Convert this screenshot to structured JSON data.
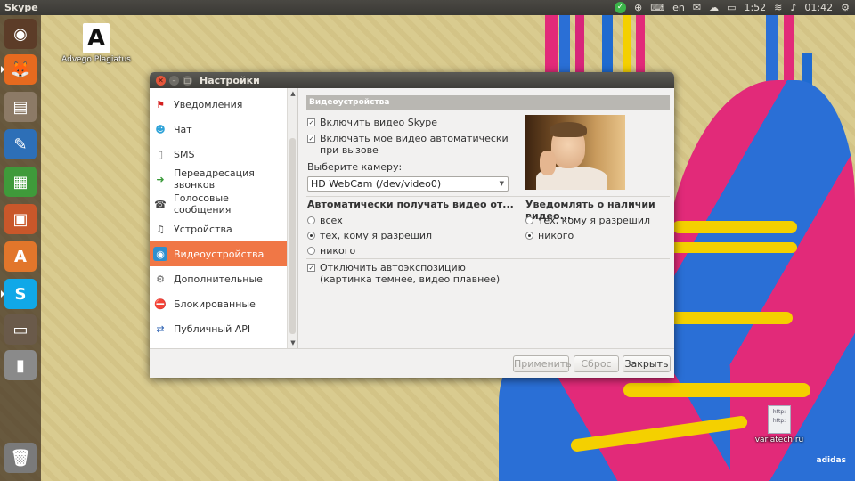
{
  "top_panel": {
    "app_title": "Skype",
    "keyboard_layout": "en",
    "battery_time": "1:52",
    "clock": "01:42"
  },
  "desktop": {
    "icons": [
      {
        "label": "Advego Plagiatus",
        "glyph": "A"
      },
      {
        "label": "variatech.ru",
        "glyph_lines": [
          "http:",
          "http:"
        ]
      }
    ]
  },
  "launcher": {
    "items": [
      {
        "name": "ubuntu-dash",
        "glyph": "◉",
        "color": "#5c3c28"
      },
      {
        "name": "firefox",
        "glyph": "🦊",
        "color": "#e66a1f"
      },
      {
        "name": "files",
        "glyph": "▤",
        "color": "#8c7a66"
      },
      {
        "name": "writer",
        "glyph": "✎",
        "color": "#2d6fb7"
      },
      {
        "name": "calc",
        "glyph": "▦",
        "color": "#3f9a3a"
      },
      {
        "name": "impress",
        "glyph": "▣",
        "color": "#c9572a"
      },
      {
        "name": "software-center",
        "glyph": "A",
        "color": "#e2762b"
      },
      {
        "name": "skype",
        "glyph": "S",
        "color": "#10a8e8"
      },
      {
        "name": "workspaces",
        "glyph": "▭",
        "color": "#6a5a4a"
      },
      {
        "name": "usb-drive",
        "glyph": "▮",
        "color": "#8a8a8a"
      },
      {
        "name": "trash",
        "glyph": "🗑",
        "color": "#7a7a7a"
      }
    ]
  },
  "window": {
    "title": "Настройки",
    "sidebar": {
      "items": [
        {
          "label": "Уведомления",
          "icon": "flag-icon",
          "glyph": "⚑",
          "color": "#d42020",
          "selected": false
        },
        {
          "label": "Чат",
          "icon": "chat-icon",
          "glyph": "☻",
          "color": "#2fa3d8",
          "selected": false
        },
        {
          "label": "SMS",
          "icon": "phone-icon",
          "glyph": "▯",
          "color": "#777777",
          "selected": false
        },
        {
          "label": "Переадресация звонков",
          "icon": "forward-call-icon",
          "glyph": "➜",
          "color": "#3a9a3a",
          "selected": false
        },
        {
          "label": "Голосовые сообщения",
          "icon": "voicemail-icon",
          "glyph": "☎",
          "color": "#444444",
          "selected": false
        },
        {
          "label": "Устройства",
          "icon": "headset-icon",
          "glyph": "♫",
          "color": "#555555",
          "selected": false
        },
        {
          "label": "Видеоустройства",
          "icon": "webcam-icon",
          "glyph": "◉",
          "color": "#2f8fcf",
          "selected": true
        },
        {
          "label": "Дополнительные",
          "icon": "gear-icon",
          "glyph": "⚙",
          "color": "#666666",
          "selected": false
        },
        {
          "label": "Блокированные",
          "icon": "blocked-user-icon",
          "glyph": "⛔",
          "color": "#c88a3a",
          "selected": false
        },
        {
          "label": "Публичный API",
          "icon": "api-arrows-icon",
          "glyph": "⇄",
          "color": "#2a5fb0",
          "selected": false
        }
      ]
    },
    "content": {
      "section_title": "Видеоустройства",
      "enable_video": {
        "label": "Включить видео Skype",
        "checked": true
      },
      "auto_start_video": {
        "label_line1": "Включать мое видео автоматически",
        "label_line2": "при вызове",
        "checked": true
      },
      "camera_label": "Выберите камеру:",
      "camera_value": "HD WebCam (/dev/video0)",
      "receive_group": {
        "title": "Автоматически получать видео от...",
        "options": [
          {
            "label": "всех",
            "selected": false
          },
          {
            "label": "тех, кому я разрешил",
            "selected": true
          },
          {
            "label": "никого",
            "selected": false
          }
        ]
      },
      "notify_group": {
        "title": "Уведомлять о наличии видео...",
        "options": [
          {
            "label": "тех, кому я разрешил",
            "selected": false
          },
          {
            "label": "никого",
            "selected": true
          }
        ]
      },
      "auto_exposure": {
        "label_line1": "Отключить автоэкспозицию",
        "label_line2": "(картинка темнее, видео плавнее)",
        "checked": true
      }
    },
    "footer": {
      "apply": "Применить",
      "reset": "Сброс",
      "close": "Закрыть"
    }
  },
  "watermark": "adidas"
}
